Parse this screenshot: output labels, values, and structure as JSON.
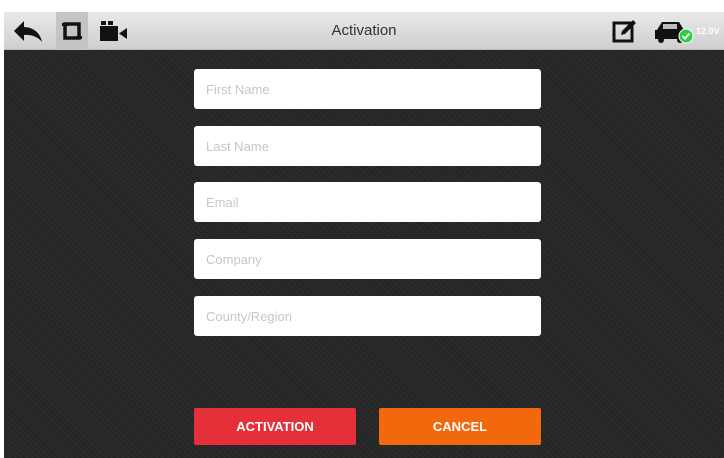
{
  "header": {
    "title": "Activation",
    "voltage": "12.0V",
    "icons": {
      "back": "back-arrow-icon",
      "screenshot": "crop-icon",
      "record": "video-camera-icon",
      "edit": "edit-icon",
      "vehicle": "car-connected-icon"
    }
  },
  "form": {
    "fields": [
      {
        "placeholder": "First Name",
        "value": ""
      },
      {
        "placeholder": "Last Name",
        "value": ""
      },
      {
        "placeholder": "Email",
        "value": ""
      },
      {
        "placeholder": "Company",
        "value": ""
      },
      {
        "placeholder": "County/Region",
        "value": ""
      }
    ]
  },
  "buttons": {
    "activation": "ACTIVATION",
    "cancel": "CANCEL"
  },
  "colors": {
    "activation": "#e5303a",
    "cancel": "#f2690d",
    "background": "#262626",
    "status_ok": "#2ecc40"
  }
}
